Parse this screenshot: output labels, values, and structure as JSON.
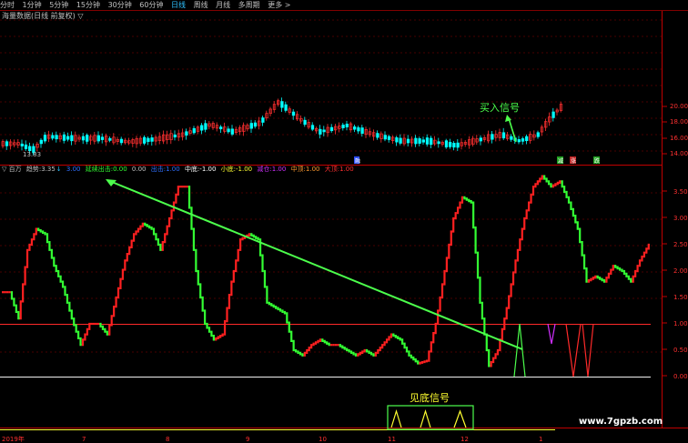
{
  "toolbar": {
    "items": [
      "分时",
      "1分钟",
      "5分钟",
      "15分钟",
      "30分钟",
      "60分钟",
      "日线",
      "周线",
      "月线",
      "多周期",
      "更多 >"
    ],
    "active": "日线"
  },
  "price_panel": {
    "title": "海量数据(日线 前复权) ▽",
    "low_label": "13.83",
    "buy_signal_label": "买入信号",
    "y_ticks": [
      "20.00",
      "18.00",
      "16.00",
      "14.00"
    ],
    "markers": {
      "m1": "融",
      "m2": "减",
      "m3": "涨",
      "m4": "跌"
    }
  },
  "indicator_panel": {
    "header": {
      "title": "▽ 百万",
      "trend_label": "趋势:",
      "trend_value": "3.35",
      "arrow": "↓",
      "num1": "3.00",
      "item1_label": "延续出击:",
      "item1_value": "0.00",
      "item2_value": "0.00",
      "item3_label": "出击:",
      "item3_value": "1.00",
      "item4_label": "中底:",
      "item4_value": "-1.00",
      "item5_label": "小底:",
      "item5_value": "-1.00",
      "item6_label": "减仓:",
      "item6_value": "1.00",
      "item7_label": "中顶:",
      "item7_value": "1.00",
      "item8_label": "大顶:",
      "item8_value": "1.00"
    },
    "y_ticks": [
      "3.50",
      "3.00",
      "2.50",
      "2.00",
      "1.50",
      "1.00",
      "0.50",
      "0.00"
    ],
    "bottom_signal_label": "见底信号"
  },
  "x_axis": {
    "labels": [
      "2019年",
      "7",
      "8",
      "9",
      "10",
      "11",
      "12",
      "1"
    ]
  },
  "watermark": "www.7gpzb.com",
  "colors": {
    "up": "#ff3030",
    "down": "#00ffff",
    "ind_up": "#ff2020",
    "ind_down": "#33ff33",
    "grid": "#800000",
    "signal": "#4cff4c",
    "yellow": "#ffff30",
    "magenta": "#d030ff"
  },
  "chart_data": {
    "type": "line",
    "indicator_trend": [
      1.6,
      1.6,
      1.1,
      2.4,
      2.8,
      2.7,
      2.1,
      1.7,
      1.1,
      0.6,
      1.0,
      1.0,
      0.8,
      1.5,
      2.2,
      2.7,
      2.9,
      2.8,
      2.4,
      3.0,
      3.6,
      3.6,
      2.0,
      1.0,
      0.7,
      0.8,
      1.8,
      2.6,
      2.7,
      2.6,
      1.4,
      1.3,
      1.2,
      0.5,
      0.4,
      0.6,
      0.7,
      0.6,
      0.6,
      0.5,
      0.4,
      0.5,
      0.4,
      0.6,
      0.8,
      0.7,
      0.4,
      0.25,
      0.3,
      1.0,
      2.0,
      3.0,
      3.4,
      3.3,
      1.4,
      0.2,
      0.5,
      1.3,
      2.2,
      3.0,
      3.6,
      3.8,
      3.6,
      3.7,
      3.3,
      2.8,
      1.8,
      1.9,
      1.8,
      2.1,
      2.0,
      1.8,
      2.2,
      2.5
    ],
    "ylim": [
      0,
      3.8
    ]
  }
}
